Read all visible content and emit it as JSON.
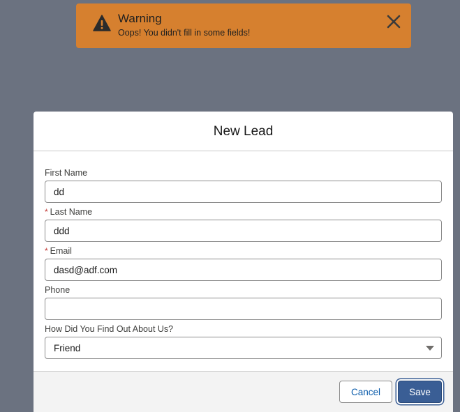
{
  "toast": {
    "title": "Warning",
    "message": "Oops! You didn't fill in some fields!",
    "icon": "warning-icon",
    "close_icon": "close-icon",
    "color": "#d6802f"
  },
  "modal": {
    "title": "New Lead",
    "fields": {
      "first_name": {
        "label": "First Name",
        "value": "dd",
        "required": false
      },
      "last_name": {
        "label": "Last Name",
        "value": "ddd",
        "required": true
      },
      "email": {
        "label": "Email",
        "value": "dasd@adf.com",
        "required": true
      },
      "phone": {
        "label": "Phone",
        "value": "",
        "required": false
      },
      "source": {
        "label": "How Did You Find Out About Us?",
        "value": "Friend"
      }
    },
    "required_marker": "*",
    "buttons": {
      "cancel": "Cancel",
      "save": "Save"
    }
  },
  "colors": {
    "backdrop": "#6b7280",
    "brand_button": "#3a5e95",
    "link_text": "#0b5cab",
    "required": "#c23934"
  }
}
